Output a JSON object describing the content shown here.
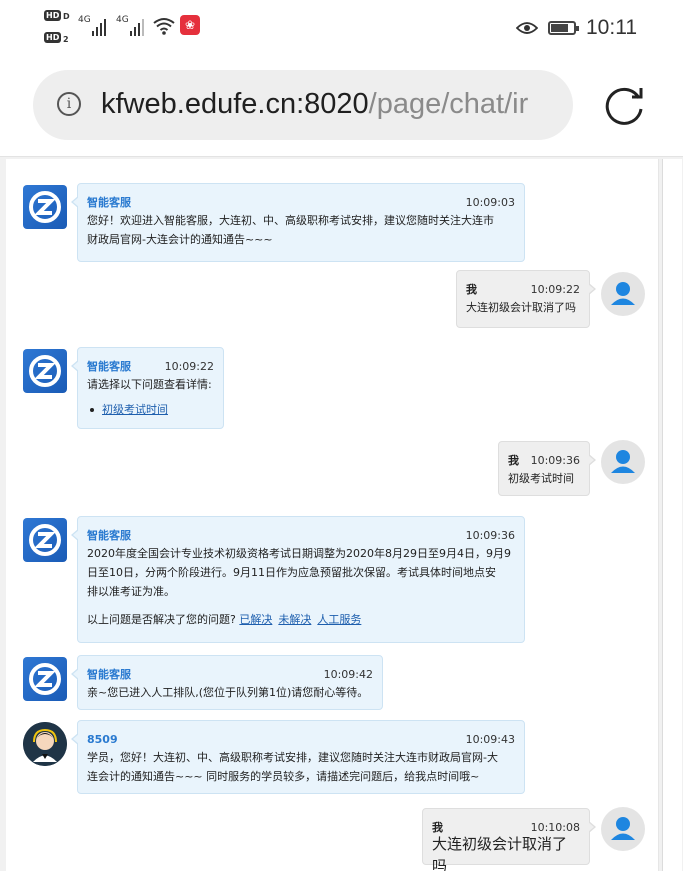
{
  "status_bar": {
    "time": "10:11",
    "network_labels": [
      "4G",
      "4G"
    ]
  },
  "address_bar": {
    "host": "kfweb.edufe.cn:8020",
    "path": "/page/chat/ir"
  },
  "colors": {
    "bot_bubble_bg": "#e9f4fc",
    "user_bubble_bg": "#efefef",
    "name_blue": "#2a7ad0",
    "link_blue": "#1e5fae"
  },
  "messages": [
    {
      "sender": "智能客服",
      "time": "10:09:03",
      "lines": [
        "您好！欢迎进入智能客服，大连初、中、高级职称考试安排，建议您随时关注大连市",
        "财政局官网-大连会计的通知通告~~~"
      ]
    },
    {
      "sender": "我",
      "time": "10:09:22",
      "text": "大连初级会计取消了吗"
    },
    {
      "sender": "智能客服",
      "time": "10:09:22",
      "text": "请选择以下问题查看详情:",
      "option": "初级考试时间"
    },
    {
      "sender": "我",
      "time": "10:09:36",
      "text": "初级考试时间"
    },
    {
      "sender": "智能客服",
      "time": "10:09:36",
      "lines": [
        "2020年度全国会计专业技术初级资格考试日期调整为2020年8月29日至9月4日，9月9",
        "日至10日，分两个阶段进行。9月11日作为应急预留批次保留。考试具体时间地点安",
        "排以准考证为准。"
      ],
      "feedback_prompt": "以上问题是否解决了您的问题?",
      "feedback_links": [
        "已解决",
        "未解决",
        "人工服务"
      ]
    },
    {
      "sender": "智能客服",
      "time": "10:09:42",
      "text": "亲~您已进入人工排队,(您位于队列第1位)请您耐心等待。"
    },
    {
      "sender": "8509",
      "time": "10:09:43",
      "lines": [
        "学员，您好！大连初、中、高级职称考试安排，建议您随时关注大连市财政局官网-大",
        "连会计的通知通告~~~ 同时服务的学员较多，请描述完问题后，给我点时间哦~"
      ]
    },
    {
      "sender": "我",
      "time": "10:10:08",
      "text": "大连初级会计取消了吗"
    }
  ]
}
